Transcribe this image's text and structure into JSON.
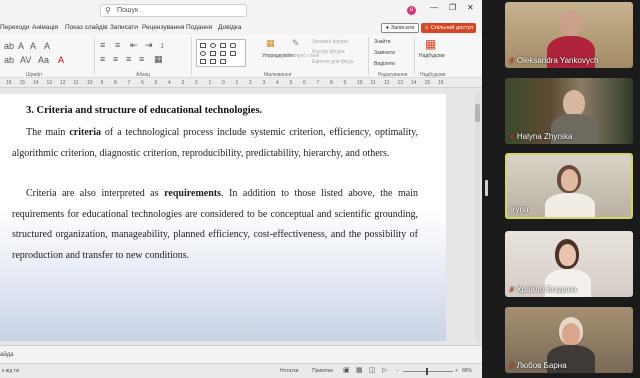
{
  "search": {
    "icon": "search-icon",
    "placeholder": "Пошук"
  },
  "account": {
    "initial": "o"
  },
  "window_controls": {
    "minimize": "—",
    "restore": "❐",
    "close": "✕"
  },
  "tabs": [
    "Переходи",
    "Анімація",
    "Показ слайдів",
    "Записати",
    "Рецензування",
    "Подання",
    "Довідка"
  ],
  "buttons": {
    "record": "● Записати",
    "share": "☺ Спільний доступ"
  },
  "ribbon": {
    "groups": {
      "font": "Шрифт",
      "paragraph": "Абзац",
      "drawing": "Малювання",
      "editing": "Редагування",
      "addins": "Надбудови"
    },
    "arrange_label": "Упорядкувати",
    "quick_styles_label": "Експрес-стилі",
    "shape_fill": "Заливка фігури",
    "shape_outline": "Контур фігури",
    "shape_effects": "Ефекти для фігур",
    "find": "Знайти",
    "replace": "Замінити",
    "select": "Виділити",
    "addins_button": "Надбудови"
  },
  "ruler_ticks": [
    "16",
    "15",
    "14",
    "13",
    "12",
    "11",
    "10",
    "9",
    "8",
    "7",
    "6",
    "5",
    "4",
    "3",
    "2",
    "1",
    "0",
    "1",
    "2",
    "3",
    "4",
    "5",
    "6",
    "7",
    "8",
    "9",
    "10",
    "11",
    "12",
    "13",
    "14",
    "15",
    "16"
  ],
  "slide": {
    "heading": "3. Criteria and structure of educational technologies.",
    "p1_a": "The main ",
    "p1_bold": "criteria",
    "p1_b": " of a technological process include systemic criterion, efficiency, optimality, algorithmic criterion, diagnostic criterion, reproducibility, predictability, hierarchy, and others.",
    "p2_a": "Criteria are also interpreted as ",
    "p2_bold": "requirements",
    "p2_b": ". In addition to those listed above, the main requirements for educational technologies are considered to be conceptual and scientific grounding, structured organization, manageability, planned efficiency, cost-effectiveness, and the possibility of reproduction and transfer to new conditions."
  },
  "notes": {
    "placeholder": "айда"
  },
  "status": {
    "left": "к від ткі",
    "notes": "Нотатки",
    "comments": "Примітки",
    "zoom": "88%"
  },
  "participants": [
    {
      "name": "Oleksandra Yankovych",
      "muted": true
    },
    {
      "name": "Halyna Zhyrska",
      "muted": true
    },
    {
      "name": "iryna",
      "muted": false,
      "active": true
    },
    {
      "name": "Крайло Богдана",
      "muted": true
    },
    {
      "name": "Любов Барна",
      "muted": true
    }
  ]
}
